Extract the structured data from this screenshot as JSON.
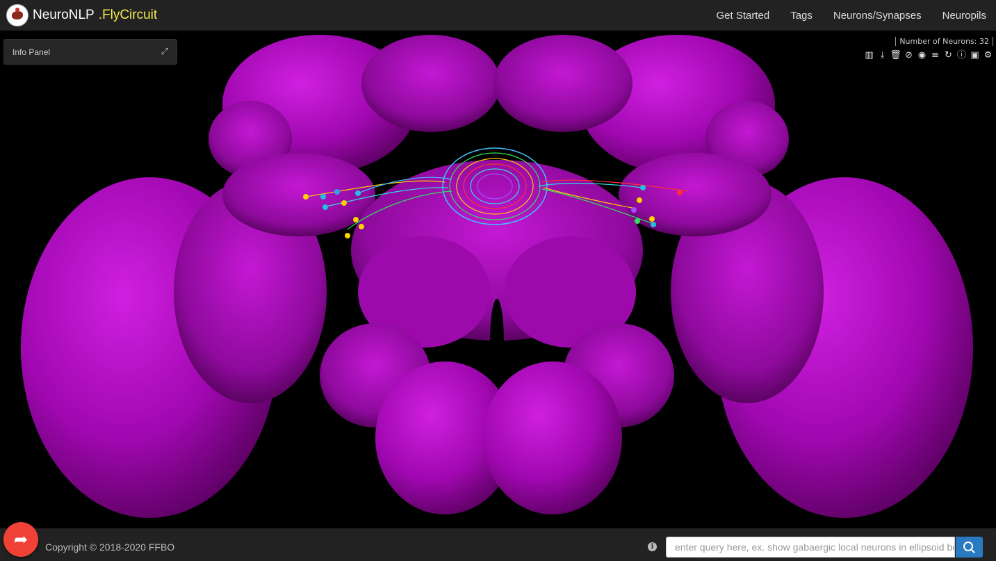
{
  "brand": {
    "name": "NeuroNLP",
    "sub": ".FlyCircuit"
  },
  "nav": {
    "items": [
      "Get Started",
      "Tags",
      "Neurons/Synapses",
      "Neuropils"
    ]
  },
  "info_panel": {
    "label": "Info Panel",
    "expand_icon": "expand-icon"
  },
  "viewer": {
    "neuron_count_label": "Number of Neurons: 32",
    "toolbar_icons": [
      "bar-chart-icon",
      "download-icon",
      "trash-icon",
      "eye-slash-icon",
      "eye-icon",
      "list-icon",
      "refresh-icon",
      "info-icon",
      "camera-icon",
      "gear-icon"
    ],
    "neuropil_color": "#b010c0"
  },
  "footer": {
    "copyright": "Copyright © 2018-2020 FFBO",
    "search_placeholder": "enter query here, ex. show gabaergic local neurons in ellipsoid body",
    "search_icon": "search-icon",
    "fab_icon": "share-arrow-icon"
  }
}
